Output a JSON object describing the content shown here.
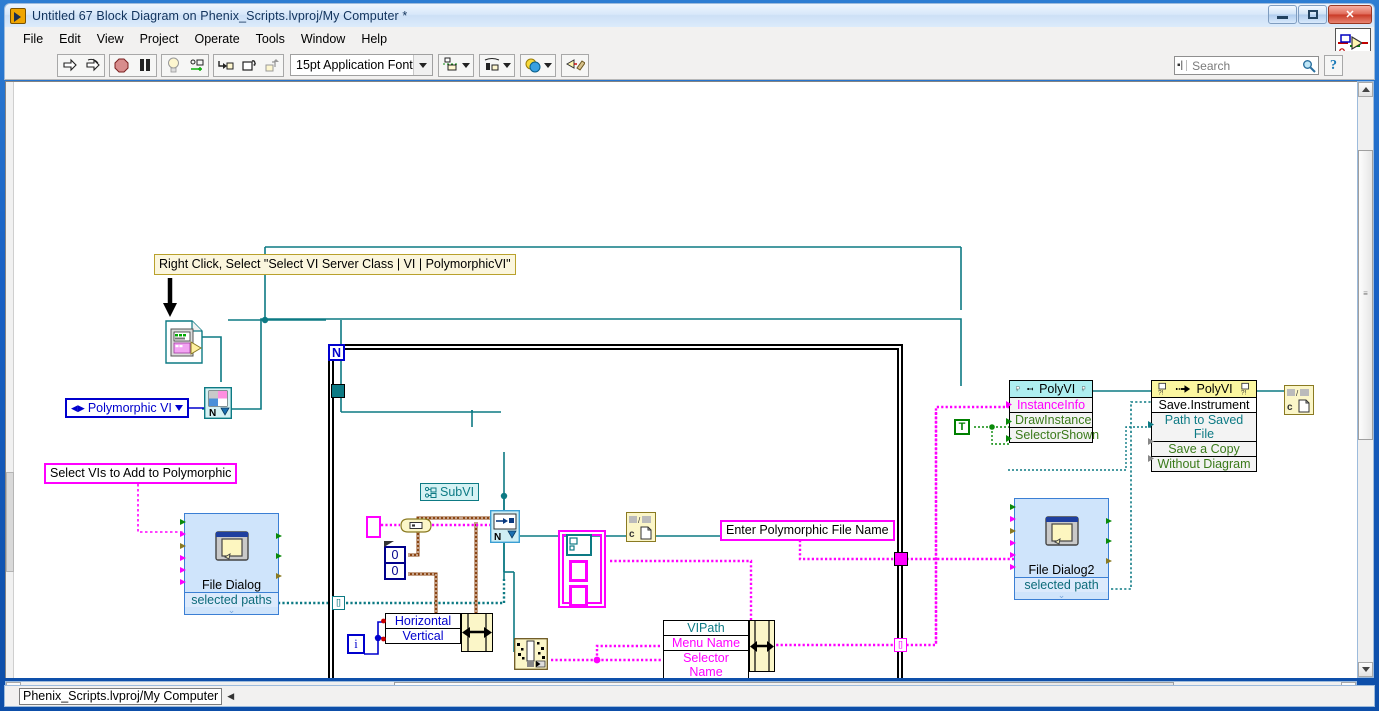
{
  "window": {
    "title": "Untitled 67 Block Diagram on Phenix_Scripts.lvproj/My Computer *",
    "icon": "labview-vi-icon",
    "minimize_label": "Minimize",
    "maximize_label": "Maximize",
    "close_label": "✕"
  },
  "menu": {
    "items": [
      {
        "label": "File"
      },
      {
        "label": "Edit"
      },
      {
        "label": "View"
      },
      {
        "label": "Project"
      },
      {
        "label": "Operate"
      },
      {
        "label": "Tools"
      },
      {
        "label": "Window"
      },
      {
        "label": "Help"
      }
    ]
  },
  "toolbar": {
    "run_label": "Run",
    "run_continuous_label": "Run Continuously",
    "abort_label": "Abort Execution",
    "pause_label": "Pause",
    "highlight_label": "Highlight Execution",
    "retain_values_label": "Retain Wire Values",
    "step_into_label": "Step Into",
    "step_over_label": "Step Over",
    "step_out_label": "Step Out",
    "font": "15pt Application Font",
    "align_label": "Align Objects",
    "distribute_label": "Distribute Objects",
    "reorder_label": "Reorder",
    "cleanup_label": "Clean Up Diagram"
  },
  "search": {
    "placeholder": "Search",
    "value": "",
    "icon": "magnifier-icon",
    "help_label": "?"
  },
  "statusbar": {
    "context": "Phenix_Scripts.lvproj/My Computer",
    "resize_handle": "◀"
  },
  "diagram": {
    "comments": [
      {
        "id": "c1",
        "text": "Right Click, Select \"Select VI Server Class | VI | PolymorphicVI\"",
        "style": "yellow"
      },
      {
        "id": "c2",
        "text": "Select VIs to Add to Polymorphic",
        "style": "magenta"
      },
      {
        "id": "c3",
        "text": "Enter Polymorphic File Name",
        "style": "magenta"
      }
    ],
    "enum_terminal": {
      "label": "Polymorphic VI"
    },
    "open_vi_ref": {
      "name": "open-vi-reference-icon"
    },
    "vi_server_ref": {
      "name": "vi-server-refnum-icon",
      "badge": "N"
    },
    "forloop": {
      "count_label": "N",
      "index_label": "i"
    },
    "file_dialog_1": {
      "title": "File Dialog",
      "output": "selected paths"
    },
    "file_dialog_2": {
      "title": "File Dialog2",
      "output": "selected path"
    },
    "subvi_tag": {
      "label": "SubVI"
    },
    "poly_property_node": {
      "header": "PolyVI",
      "rows": [
        "InstanceInfo",
        "DrawInstance",
        "SelectorShown"
      ]
    },
    "poly_invoke_node": {
      "header": "PolyVI",
      "method": "Save.Instrument",
      "rows": [
        "Path to Saved File",
        "Save a Copy",
        "Without Diagram"
      ]
    },
    "bundle_cluster": {
      "rows": [
        "VIPath",
        "Menu Name",
        "Selector Name"
      ]
    },
    "position_cluster": {
      "rows": [
        "Horizontal",
        "Vertical"
      ]
    },
    "numeric_constants": [
      "0",
      "0"
    ],
    "boolean_constant": "T",
    "path_constants": [
      {
        "id": "p1",
        "name": "path-constant-icon"
      },
      {
        "id": "p2",
        "name": "path-constant-icon"
      }
    ]
  },
  "colors": {
    "wire_path": "#0d7a84",
    "wire_string": "#ff00ff",
    "wire_refnum": "#0000cd",
    "wire_numeric": "#8b4513",
    "wire_boolean": "#008000",
    "comment_yellow_bg": "#fbf6dd",
    "comment_yellow_border": "#b9a12c",
    "subvi_blue_bg": "#cfe4fb",
    "subvi_blue_border": "#3b7fd4",
    "property_node_header": "#aeeef0",
    "invoke_node_header": "#fbf6a0"
  }
}
